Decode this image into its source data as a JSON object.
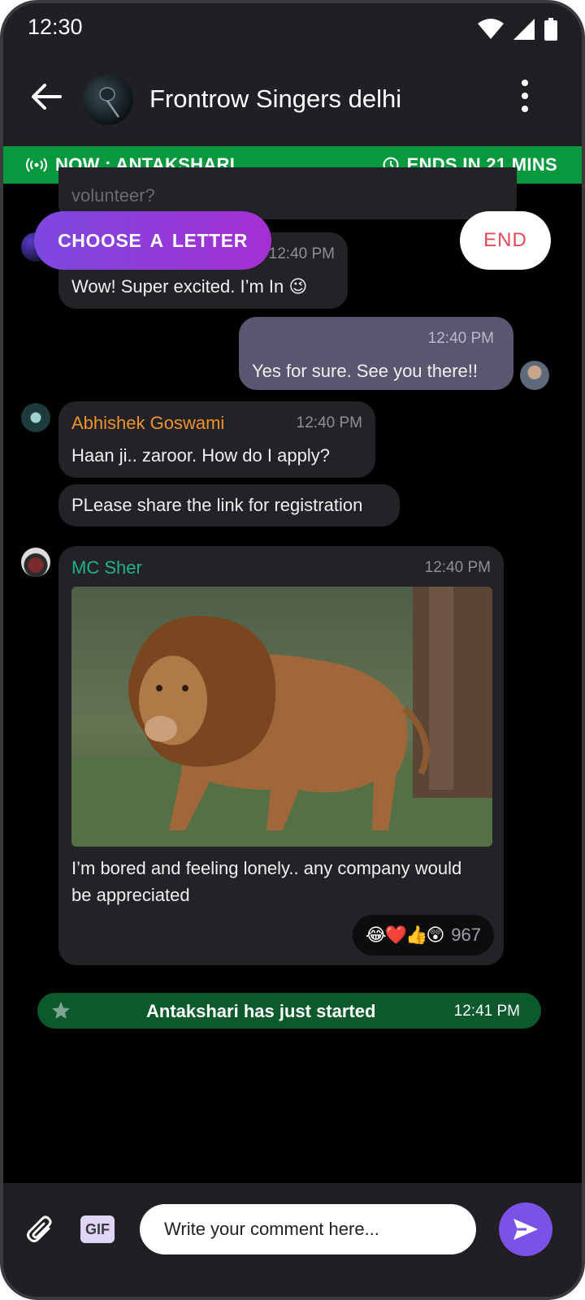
{
  "status_bar": {
    "time": "12:30",
    "icons": [
      "wifi-icon",
      "signal-icon",
      "battery-icon"
    ]
  },
  "header": {
    "title": "Frontrow Singers delhi",
    "back_icon": "arrow-left-icon",
    "menu_icon": "more-vertical-icon"
  },
  "banner": {
    "now_label": "NOW : ANTAKSHARI",
    "ends_label": "ENDS IN 21 MINS",
    "color": "#08993f"
  },
  "actions": {
    "choose_letter": "CHOOSE  A LETTER",
    "end": "END"
  },
  "messages": [
    {
      "text": "volunteer?"
    },
    {
      "time": "12:40 PM",
      "text": "Wow! Super excited. I’m In 😉"
    },
    {
      "time": "12:40 PM",
      "text": "Yes for sure. See you there!!"
    },
    {
      "sender": "Abhishek Goswami",
      "time": "12:40 PM",
      "text": "Haan ji.. zaroor. How do I apply?",
      "sender_color": "#f0922b"
    },
    {
      "text": "PLease share the link for registration"
    },
    {
      "sender": "MC Sher",
      "time": "12:40 PM",
      "sender_color": "#1fb28c",
      "text": "I’m bored and feeling lonely.. any company would be appreciated",
      "reactions": "😂❤️👍😲",
      "reaction_count": "967"
    }
  ],
  "system_message": {
    "text": "Antakshari has just started",
    "time": "12:41 PM"
  },
  "composer": {
    "placeholder": "Write your comment here...",
    "gif_label": "GIF"
  }
}
